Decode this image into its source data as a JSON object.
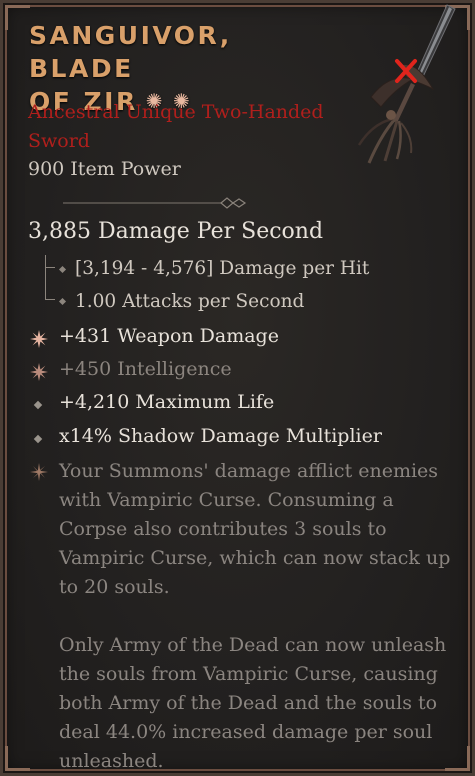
{
  "item": {
    "name": "SANGUIVOR, BLADE OF ZIR",
    "name_line1": "SANGUIVOR, BLADE",
    "name_line2": "OF ZIR",
    "type_line1": "Ancestral Unique Two-Handed",
    "type_line2": "Sword",
    "item_power": "900 Item Power",
    "title_color": "#d9a06a",
    "type_color": "#b01f1c"
  },
  "stats": {
    "dps": "3,885 Damage Per Second",
    "damage_per_hit": "[3,194 - 4,576] Damage per Hit",
    "attacks_per_second": "1.00 Attacks per Second"
  },
  "affixes": [
    {
      "text": "+431 Weapon Damage",
      "icon": "implicit-flower-icon",
      "dim": false
    },
    {
      "text": "+450 Intelligence",
      "icon": "implicit-flower-icon",
      "dim": true
    },
    {
      "text": "+4,210 Maximum Life",
      "icon": "diamond-bullet-icon",
      "dim": false
    },
    {
      "text": "x14% Shadow Damage Multiplier",
      "icon": "diamond-bullet-icon",
      "dim": false
    }
  ],
  "unique_power": {
    "icon": "unique-star-icon",
    "lines": [
      "Your Summons' damage afflict enemies",
      "with Vampiric Curse. Consuming a",
      "Corpse also contributes 3 souls to",
      "Vampiric Curse, which can now stack up",
      "to 20 souls.",
      "Only Army of the Dead can now unleash",
      "the souls from Vampiric Curse, causing",
      "both Army of the Dead and the souls to",
      "deal 44.0% increased damage per soul",
      "unleashed."
    ]
  }
}
